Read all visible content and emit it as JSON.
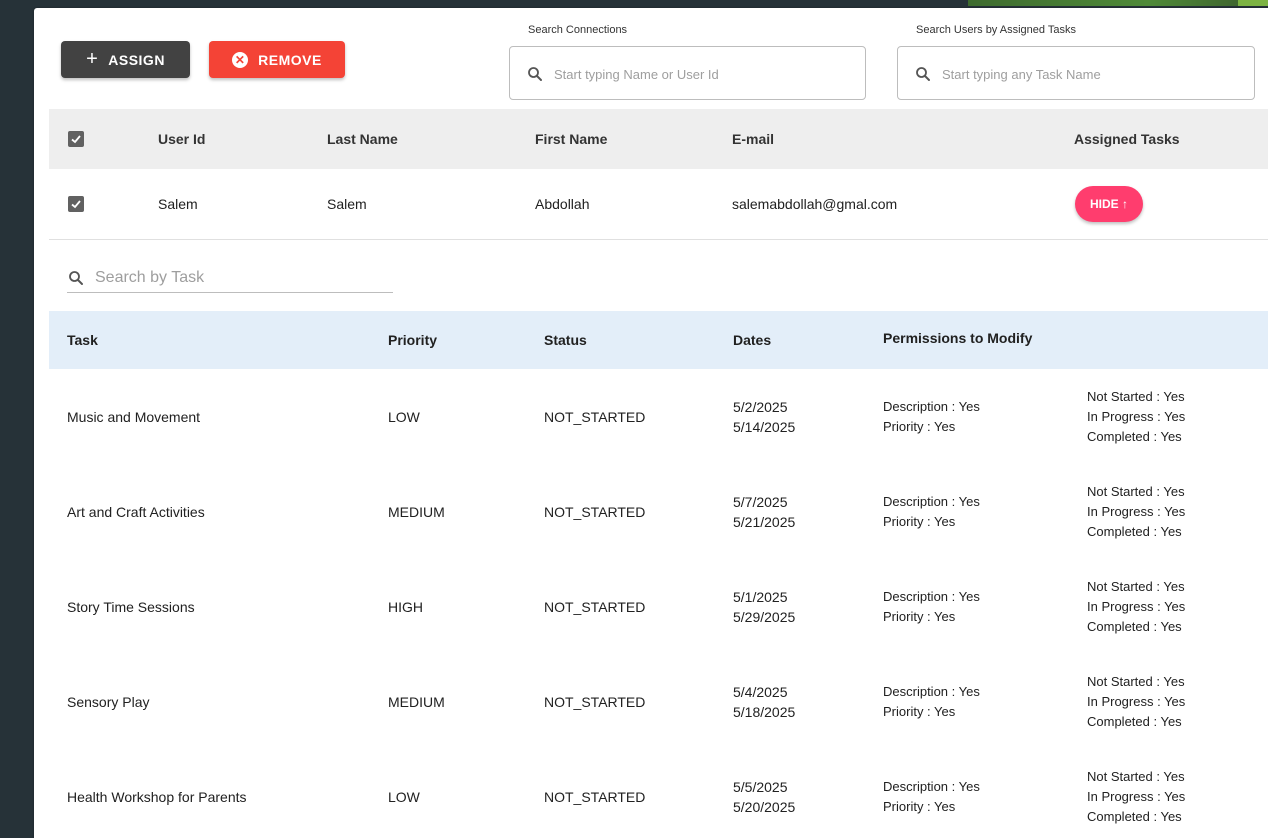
{
  "toolbar": {
    "assign_label": "ASSIGN",
    "remove_label": "REMOVE"
  },
  "search_connections": {
    "label": "Search Connections",
    "placeholder": "Start typing Name or User Id"
  },
  "search_tasks_users": {
    "label": "Search Users by Assigned Tasks",
    "placeholder": "Start typing any Task Name"
  },
  "users_table": {
    "headers": {
      "user_id": "User Id",
      "last_name": "Last Name",
      "first_name": "First Name",
      "email": "E-mail",
      "assigned_tasks": "Assigned Tasks"
    },
    "row": {
      "user_id": "Salem",
      "last_name": "Salem",
      "first_name": "Abdollah",
      "email": "salemabdollah@gmal.com",
      "hide_label": "HIDE ↑",
      "checked": true
    }
  },
  "task_search": {
    "placeholder": "Search by Task"
  },
  "tasks_table": {
    "headers": {
      "task": "Task",
      "priority": "Priority",
      "status": "Status",
      "dates": "Dates",
      "permissions": "Permissions to Modify"
    },
    "rows": [
      {
        "task": "Music and Movement",
        "priority": "LOW",
        "status": "NOT_STARTED",
        "start": "5/2/2025",
        "end": "5/14/2025",
        "perm_desc": "Description : Yes",
        "perm_prio": "Priority : Yes",
        "not_started": "Not Started : Yes",
        "in_progress": "In Progress : Yes",
        "completed": "Completed : Yes"
      },
      {
        "task": "Art and Craft Activities",
        "priority": "MEDIUM",
        "status": "NOT_STARTED",
        "start": "5/7/2025",
        "end": "5/21/2025",
        "perm_desc": "Description : Yes",
        "perm_prio": "Priority : Yes",
        "not_started": "Not Started : Yes",
        "in_progress": "In Progress : Yes",
        "completed": "Completed : Yes"
      },
      {
        "task": "Story Time Sessions",
        "priority": "HIGH",
        "status": "NOT_STARTED",
        "start": "5/1/2025",
        "end": "5/29/2025",
        "perm_desc": "Description : Yes",
        "perm_prio": "Priority : Yes",
        "not_started": "Not Started : Yes",
        "in_progress": "In Progress : Yes",
        "completed": "Completed : Yes"
      },
      {
        "task": "Sensory Play",
        "priority": "MEDIUM",
        "status": "NOT_STARTED",
        "start": "5/4/2025",
        "end": "5/18/2025",
        "perm_desc": "Description : Yes",
        "perm_prio": "Priority : Yes",
        "not_started": "Not Started : Yes",
        "in_progress": "In Progress : Yes",
        "completed": "Completed : Yes"
      },
      {
        "task": "Health Workshop for Parents",
        "priority": "LOW",
        "status": "NOT_STARTED",
        "start": "5/5/2025",
        "end": "5/20/2025",
        "perm_desc": "Description : Yes",
        "perm_prio": "Priority : Yes",
        "not_started": "Not Started : Yes",
        "in_progress": "In Progress : Yes",
        "completed": "Completed : Yes"
      }
    ]
  },
  "colors": {
    "assign": "#424242",
    "remove": "#f44336",
    "hide": "#ff3d6e",
    "tasks_header_bg": "#e3eef9"
  }
}
